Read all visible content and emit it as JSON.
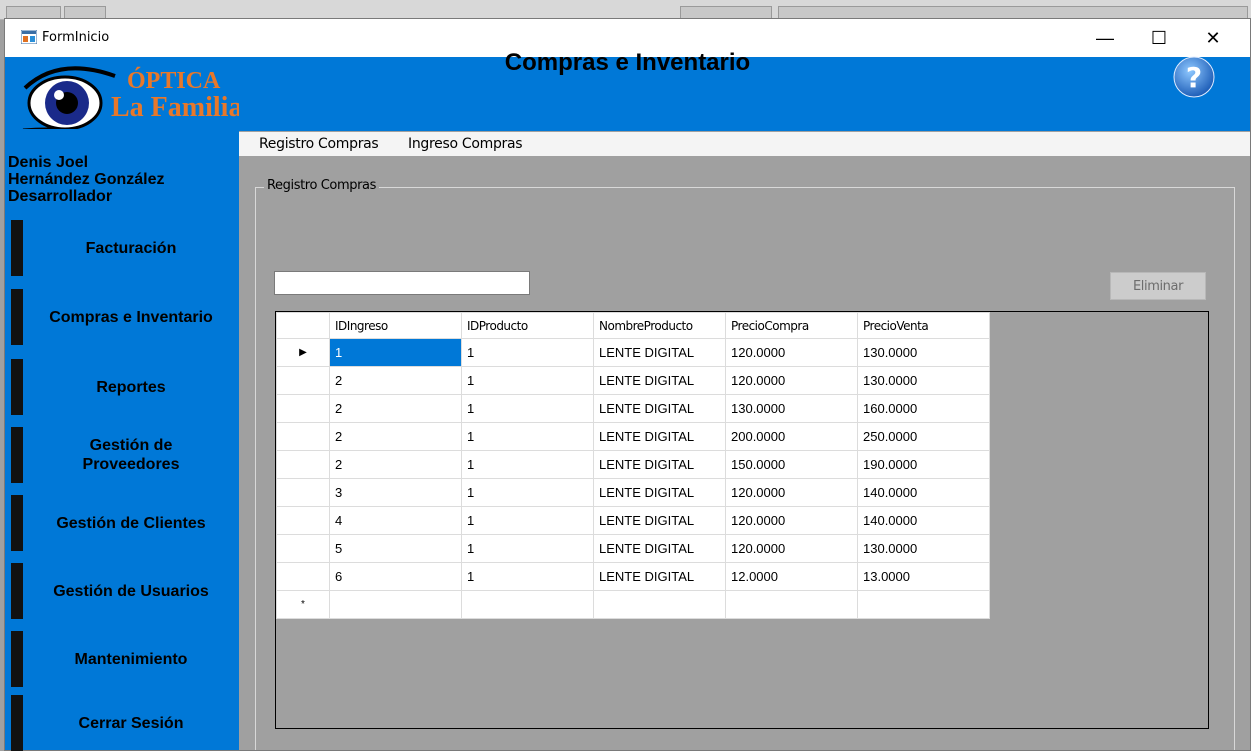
{
  "window": {
    "title": "FormInicio",
    "controls": {
      "minimize": "—",
      "maximize": "☐",
      "close": "✕"
    }
  },
  "header": {
    "logo_text_line1": "ÓPTICA",
    "logo_text_line2": "La Familia",
    "title": "Compras e Inventario",
    "help_icon": "help-icon"
  },
  "sidebar": {
    "user_name_line1": "Denis Joel",
    "user_name_line2": "Hernández González",
    "user_role": "Desarrollador",
    "items": [
      {
        "label": "Facturación"
      },
      {
        "label": "Compras e Inventario"
      },
      {
        "label": "Reportes"
      },
      {
        "label": "Gestión de Proveedores"
      },
      {
        "label": "Gestión de Clientes"
      },
      {
        "label": "Gestión de Usuarios"
      },
      {
        "label": "Mantenimiento"
      },
      {
        "label": "Cerrar Sesión"
      }
    ]
  },
  "menu": {
    "items": [
      {
        "label": "Registro Compras"
      },
      {
        "label": "Ingreso Compras"
      }
    ]
  },
  "group": {
    "legend": "Registro Compras",
    "search_value": "",
    "delete_button": "Eliminar"
  },
  "grid": {
    "columns": [
      "IDIngreso",
      "IDProducto",
      "NombreProducto",
      "PrecioCompra",
      "PrecioVenta"
    ],
    "current_row_marker": "▶",
    "new_row_marker": "*",
    "rows": [
      [
        "1",
        "1",
        "LENTE DIGITAL",
        "120.0000",
        "130.0000"
      ],
      [
        "2",
        "1",
        "LENTE DIGITAL",
        "120.0000",
        "130.0000"
      ],
      [
        "2",
        "1",
        "LENTE DIGITAL",
        "130.0000",
        "160.0000"
      ],
      [
        "2",
        "1",
        "LENTE DIGITAL",
        "200.0000",
        "250.0000"
      ],
      [
        "2",
        "1",
        "LENTE DIGITAL",
        "150.0000",
        "190.0000"
      ],
      [
        "3",
        "1",
        "LENTE DIGITAL",
        "120.0000",
        "140.0000"
      ],
      [
        "4",
        "1",
        "LENTE DIGITAL",
        "120.0000",
        "140.0000"
      ],
      [
        "5",
        "1",
        "LENTE DIGITAL",
        "120.0000",
        "130.0000"
      ],
      [
        "6",
        "1",
        "LENTE DIGITAL",
        "12.0000",
        "13.0000"
      ]
    ]
  },
  "colors": {
    "accent": "#0078d7",
    "form_background": "#a0a0a0",
    "nav_marker": "#111111"
  }
}
